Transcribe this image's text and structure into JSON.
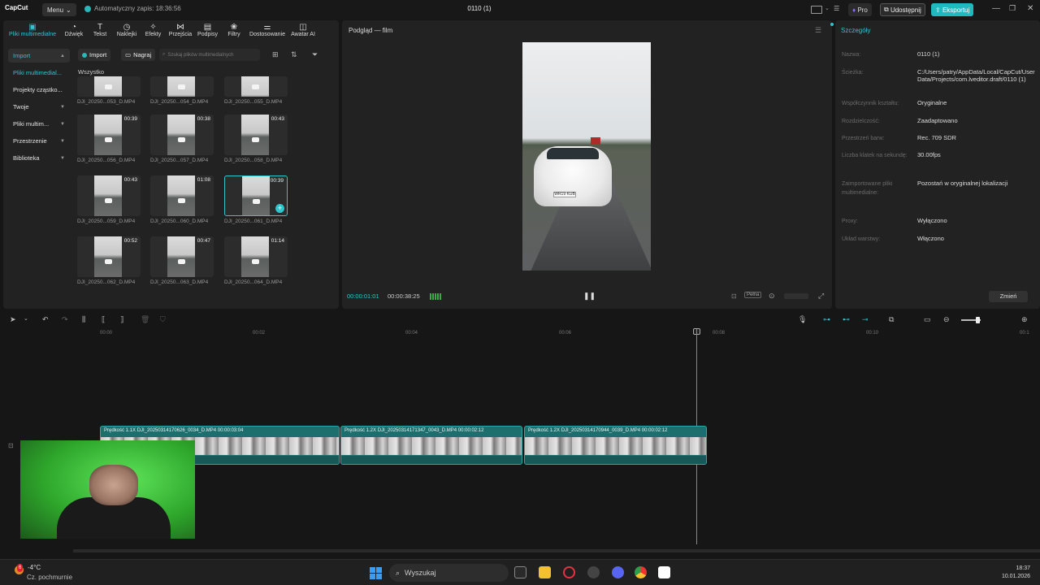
{
  "titlebar": {
    "app_name": "CapCut",
    "menu_label": "Menu",
    "autosave": "Automatyczny zapis: 18:36:56",
    "project_title": "0110 (1)",
    "pro_label": "Pro",
    "share_label": "Udostępnij",
    "export_label": "Eksportuj",
    "accent_color": "#1fb9c0"
  },
  "toolbar": {
    "tabs": [
      {
        "label": "Pliki multimedialne",
        "icon": "media-icon"
      },
      {
        "label": "Dźwięk",
        "icon": "audio-icon"
      },
      {
        "label": "Tekst",
        "icon": "text-icon"
      },
      {
        "label": "Naklejki",
        "icon": "sticker-icon"
      },
      {
        "label": "Efekty",
        "icon": "effects-icon"
      },
      {
        "label": "Przejścia",
        "icon": "transitions-icon"
      },
      {
        "label": "Podpisy",
        "icon": "captions-icon"
      },
      {
        "label": "Filtry",
        "icon": "filters-icon"
      },
      {
        "label": "Dostosowanie",
        "icon": "adjust-icon"
      },
      {
        "label": "Awatar AI",
        "icon": "avatar-icon"
      }
    ]
  },
  "sidebar": {
    "items": [
      {
        "label": "Import"
      },
      {
        "label": "Pliki multimedial..."
      },
      {
        "label": "Projekty cząstko..."
      },
      {
        "label": "Twoje"
      },
      {
        "label": "Pliki multim..."
      },
      {
        "label": "Przestrzenie"
      },
      {
        "label": "Biblioteka"
      }
    ]
  },
  "media": {
    "import_label": "Import",
    "record_label": "Nagraj",
    "search_placeholder": "Szukaj plików multimedialnych",
    "section_label": "Wszystko",
    "items": [
      {
        "name": "DJI_20250...053_D.MP4",
        "duration": ""
      },
      {
        "name": "DJI_20250...054_D.MP4",
        "duration": ""
      },
      {
        "name": "DJI_20250...055_D.MP4",
        "duration": ""
      },
      {
        "name": "DJI_20250...056_D.MP4",
        "duration": "00:39"
      },
      {
        "name": "DJI_20250...057_D.MP4",
        "duration": "00:38"
      },
      {
        "name": "DJI_20250...058_D.MP4",
        "duration": "00:43"
      },
      {
        "name": "DJI_20250...059_D.MP4",
        "duration": "00:43"
      },
      {
        "name": "DJI_20250...060_D.MP4",
        "duration": "01:08"
      },
      {
        "name": "DJI_20250...061_D.MP4",
        "duration": "00:39"
      },
      {
        "name": "DJI_20250...062_D.MP4",
        "duration": "00:52"
      },
      {
        "name": "DJI_20250...063_D.MP4",
        "duration": "00:47"
      },
      {
        "name": "DJI_20250...064_D.MP4",
        "duration": "01:14"
      }
    ]
  },
  "preview": {
    "title": "Podgląd — film",
    "plate": "WR19 KUB",
    "time_current": "00:00:01:01",
    "time_total": "00:00:38:25",
    "fullscreen_label": "Pełna"
  },
  "details": {
    "title": "Szczegóły",
    "rows": [
      {
        "label": "Nazwa:",
        "value": "0110 (1)"
      },
      {
        "label": "Ścieżka:",
        "value": "C:/Users/patry/AppData/Local/CapCut/User Data/Projects/com.lveditor.draft/0110 (1)"
      },
      {
        "label": "Współczynnik kształtu:",
        "value": "Oryginalne"
      },
      {
        "label": "Rozdzielczość:",
        "value": "Zaadaptowano"
      },
      {
        "label": "Przestrzeń barw:",
        "value": "Rec. 709 SDR"
      },
      {
        "label": "Liczba klatek na sekundę:",
        "value": "30.00fps"
      },
      {
        "label": "Zaimportowane pliki multimedialne:",
        "value": "Pozostań w oryginalnej lokalizacji"
      },
      {
        "label": "Proxy:",
        "value": "Wyłączono"
      },
      {
        "label": "Układ warstwy:",
        "value": "Włączono"
      }
    ],
    "change_label": "Zmień"
  },
  "timeline": {
    "ticks": [
      "00:00",
      "00:02",
      "00:04",
      "00:06",
      "00:08",
      "00:10",
      "00:1"
    ],
    "clips": [
      {
        "label": "Prędkość 1.1X   DJI_20250314170626_0034_D.MP4   00:00:03:04"
      },
      {
        "label": "Prędkość 1.2X   DJI_20250314171347_0043_D.MP4   00:00:02:12"
      },
      {
        "label": "Prędkość 1.2X   DJI_20250314170944_0039_D.MP4   00:00:02:12"
      }
    ],
    "clip_color": "#1d6f6d"
  },
  "taskbar": {
    "temperature": "-4°C",
    "weather": "Cz. pochmurnie",
    "weather_badge": "6",
    "search_label": "Wyszukaj",
    "time": "18:37",
    "date": "10.01.2026"
  }
}
